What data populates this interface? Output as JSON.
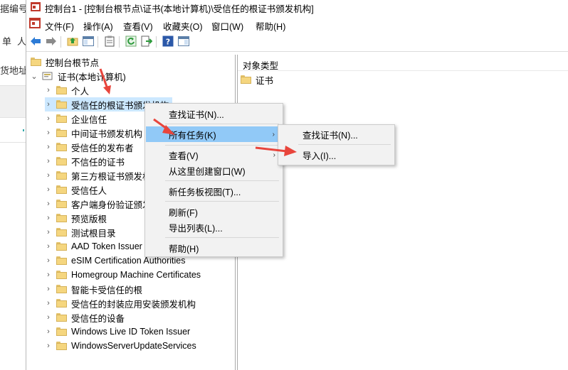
{
  "background_app": {
    "fragments": [
      "据编号",
      "单",
      "人",
      "货地址"
    ]
  },
  "window": {
    "title": "控制台1 - [控制台根节点\\证书(本地计算机)\\受信任的根证书颁发机构]",
    "menu": [
      "文件(F)",
      "操作(A)",
      "查看(V)",
      "收藏夹(O)",
      "窗口(W)",
      "帮助(H)"
    ]
  },
  "tree": {
    "root": "控制台根节点",
    "store": "证书(本地计算机)",
    "items": [
      "个人",
      "受信任的根证书颁发机构",
      "企业信任",
      "中间证书颁发机构",
      "受信任的发布者",
      "不信任的证书",
      "第三方根证书颁发机构",
      "受信任人",
      "客户端身份验证颁发",
      "预览版根",
      "测试根目录",
      "AAD Token Issuer",
      "eSIM Certification Authorities",
      "Homegroup Machine Certificates",
      "智能卡受信任的根",
      "受信任的封装应用安装颁发机构",
      "受信任的设备",
      "Windows Live ID Token Issuer",
      "WindowsServerUpdateServices"
    ]
  },
  "right_pane": {
    "header": "对象类型",
    "items": [
      "证书"
    ]
  },
  "context_menu": {
    "items": [
      "查找证书(N)...",
      "所有任务(K)",
      "查看(V)",
      "从这里创建窗口(W)",
      "新任务板视图(T)...",
      "刷新(F)",
      "导出列表(L)...",
      "帮助(H)"
    ]
  },
  "submenu": {
    "items": [
      "查找证书(N)...",
      "导入(I)..."
    ]
  },
  "colors": {
    "highlight": "#91c9f7",
    "folder": "#f5d67f",
    "arrow": "#e8453c"
  }
}
